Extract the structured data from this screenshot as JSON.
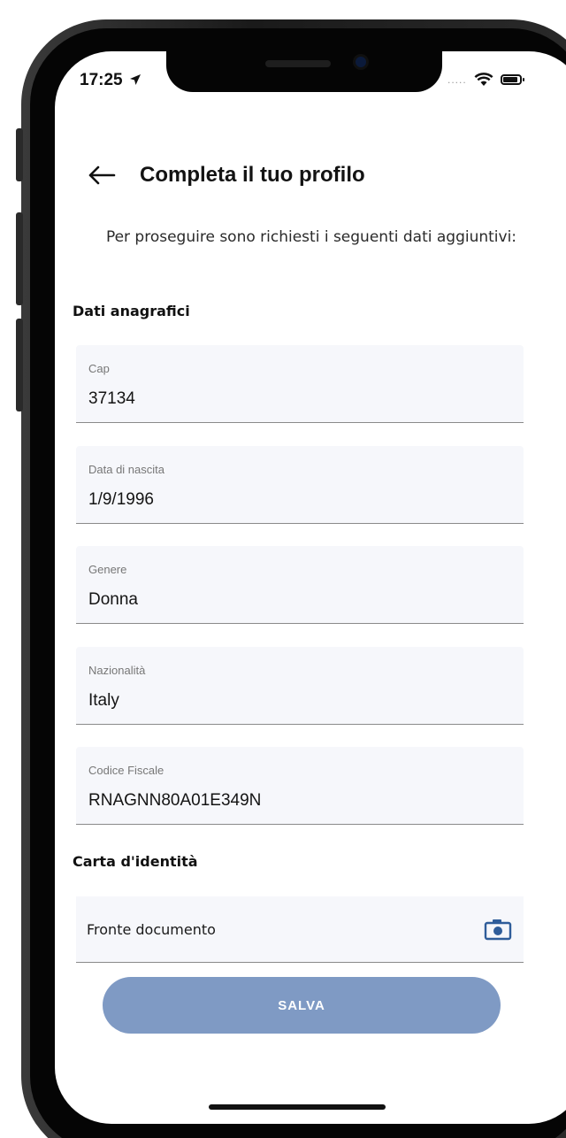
{
  "status_bar": {
    "time": "17:25",
    "signal": "....."
  },
  "header": {
    "title": "Completa il tuo profilo"
  },
  "intro": {
    "text": "Per proseguire sono richiesti i seguenti dati aggiuntivi:"
  },
  "personal_section": {
    "title": "Dati anagrafici",
    "fields": [
      {
        "label": "Cap",
        "value": "37134"
      },
      {
        "label": "Data di nascita",
        "value": "1/9/1996"
      },
      {
        "label": "Genere",
        "value": "Donna"
      },
      {
        "label": "Nazionalità",
        "value": "Italy"
      },
      {
        "label": "Codice Fiscale",
        "value": "RNAGNN80A01E349N"
      }
    ]
  },
  "id_section": {
    "title": "Carta d'identità",
    "front_label": "Fronte documento"
  },
  "actions": {
    "save_label": "SALVA"
  },
  "icons": {
    "back": "arrow-left-icon",
    "camera": "camera-icon",
    "wifi": "wifi-icon",
    "battery": "battery-icon",
    "location": "location-arrow-icon"
  },
  "colors": {
    "save_button": "#7f9ac4",
    "field_background": "#f6f7fb",
    "camera_icon": "#2f5d9a"
  }
}
